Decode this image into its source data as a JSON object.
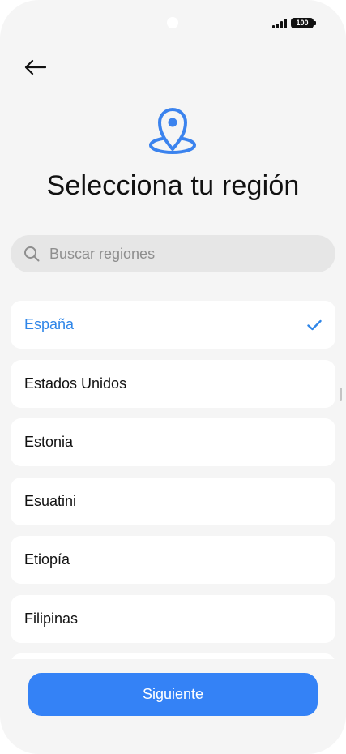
{
  "status_bar": {
    "battery_level": "100",
    "icons": [
      "signal-icon",
      "battery-icon"
    ]
  },
  "header": {
    "back_icon": "arrow-left-icon",
    "hero_icon": "location-pin-icon",
    "title": "Selecciona tu región"
  },
  "search": {
    "placeholder": "Buscar regiones",
    "value": "",
    "icon": "search-icon"
  },
  "regions": {
    "selected_index": 0,
    "items": [
      {
        "label": "España"
      },
      {
        "label": "Estados Unidos"
      },
      {
        "label": "Estonia"
      },
      {
        "label": "Esuatini"
      },
      {
        "label": "Etiopía"
      },
      {
        "label": "Filipinas"
      },
      {
        "label": ""
      }
    ]
  },
  "footer": {
    "next_label": "Siguiente"
  },
  "colors": {
    "accent": "#3482f6",
    "selected_text": "#2f86e8",
    "background": "#f5f5f5",
    "card": "#ffffff",
    "search_bg": "#e6e6e6"
  }
}
